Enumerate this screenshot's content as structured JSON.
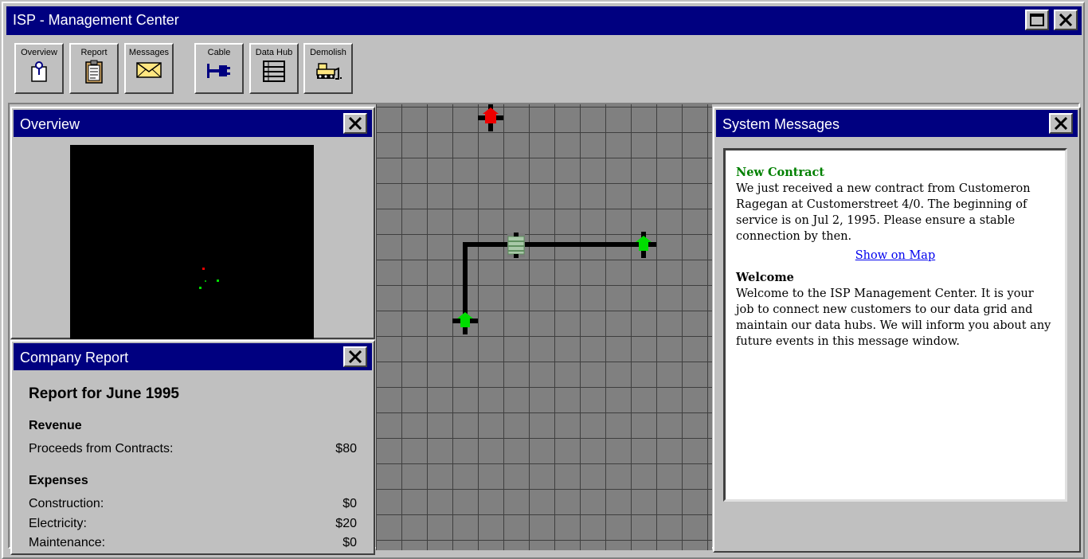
{
  "window": {
    "title": "ISP - Management Center"
  },
  "toolbar": {
    "buttons": [
      {
        "label": "Overview",
        "icon": "overview-icon"
      },
      {
        "label": "Report",
        "icon": "clipboard-icon"
      },
      {
        "label": "Messages",
        "icon": "envelope-icon"
      },
      {
        "label": "Cable",
        "icon": "cable-icon"
      },
      {
        "label": "Data Hub",
        "icon": "data-hub-icon"
      },
      {
        "label": "Demolish",
        "icon": "bulldozer-icon"
      }
    ]
  },
  "overview": {
    "title": "Overview"
  },
  "report": {
    "title": "Company Report",
    "heading": "Report for June 1995",
    "revenue_heading": "Revenue",
    "revenue": [
      {
        "label": "Proceeds from Contracts:",
        "value": "$80"
      }
    ],
    "expenses_heading": "Expenses",
    "expenses": [
      {
        "label": "Construction:",
        "value": "$0"
      },
      {
        "label": "Electricity:",
        "value": "$20"
      },
      {
        "label": "Maintenance:",
        "value": "$0"
      }
    ]
  },
  "messages": {
    "title": "System Messages",
    "items": [
      {
        "heading": "New Contract",
        "body": "We just received a new contract from Customeron Ragegan at Customerstreet 4/0. The beginning of service is on Jul 2, 1995. Please ensure a stable connection by then.",
        "link": "Show on Map"
      },
      {
        "heading": "Welcome",
        "body": "Welcome to the ISP Management Center. It is your job to connect new customers to our data grid and maintain our data hubs. We will inform you about any future events in this message window."
      }
    ]
  },
  "colors": {
    "titlebar": "#000080",
    "panel": "#c0c0c0",
    "contract_heading": "#008000",
    "customer_connected": "#00dd00",
    "customer_pending": "#ee0000",
    "link": "#0000ee"
  }
}
